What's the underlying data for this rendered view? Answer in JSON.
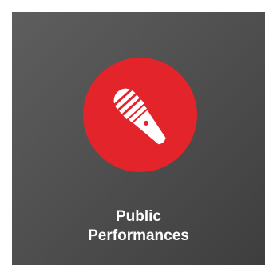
{
  "tile": {
    "icon": "microphone-icon",
    "title_line1": "Public",
    "title_line2": "Performances"
  },
  "colors": {
    "tile_background": "#505050",
    "icon_circle": "#e3242b",
    "text": "#ffffff"
  }
}
